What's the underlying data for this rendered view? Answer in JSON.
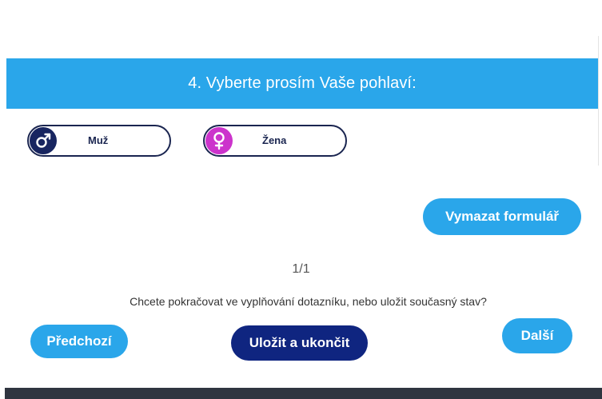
{
  "question": {
    "text": "4. Vyberte prosím Vaše pohlaví:"
  },
  "options": [
    {
      "label": "Muž",
      "icon": "male-symbol-icon",
      "icon_color": "#182560"
    },
    {
      "label": "Žena",
      "icon": "female-symbol-icon",
      "icon_color": "#cc33cc"
    }
  ],
  "actions": {
    "clear_label": "Vymazat formulář",
    "prev_label": "Předchozí",
    "save_label": "Uložit a ukončit",
    "next_label": "Další"
  },
  "pagination": {
    "counter": "1/1"
  },
  "save_prompt": "Chcete pokračovat ve vyplňování dotazníku, nebo uložit současný stav?",
  "colors": {
    "accent": "#2aa6ea",
    "primary_dark": "#0f2580",
    "border": "#1a2550",
    "footer": "#2f3540"
  }
}
